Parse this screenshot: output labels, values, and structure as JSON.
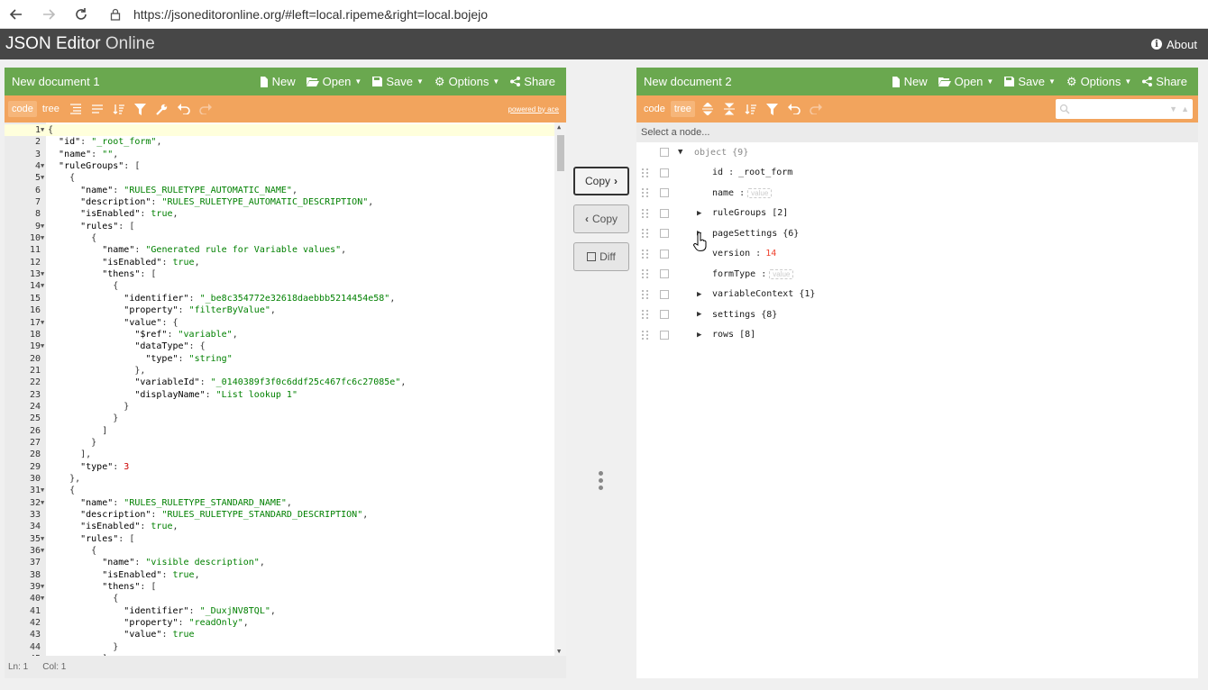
{
  "browser": {
    "url": "https://jsoneditoronline.org/#left=local.ripeme&right=local.bojejo"
  },
  "app": {
    "title_main": "JSON Editor",
    "title_light": "Online",
    "about": "About"
  },
  "left": {
    "title": "New document 1",
    "menu": {
      "new": "New",
      "open": "Open",
      "save": "Save",
      "options": "Options",
      "share": "Share"
    },
    "mode_code": "code",
    "mode_tree": "tree",
    "powered": "powered by ace",
    "status_ln": "Ln: 1",
    "status_col": "Col: 1"
  },
  "right": {
    "title": "New document 2",
    "menu": {
      "new": "New",
      "open": "Open",
      "save": "Save",
      "options": "Options",
      "share": "Share"
    },
    "mode_code": "code",
    "mode_tree": "tree",
    "nav_placeholder": "Select a node..."
  },
  "center": {
    "copy_right": "Copy",
    "copy_left": "Copy",
    "diff": "Diff"
  },
  "code_lines": [
    "{",
    "  \"id\": \"_root_form\",",
    "  \"name\": \"\",",
    "  \"ruleGroups\": [",
    "    {",
    "      \"name\": \"RULES_RULETYPE_AUTOMATIC_NAME\",",
    "      \"description\": \"RULES_RULETYPE_AUTOMATIC_DESCRIPTION\",",
    "      \"isEnabled\": true,",
    "      \"rules\": [",
    "        {",
    "          \"name\": \"Generated rule for Variable values\",",
    "          \"isEnabled\": true,",
    "          \"thens\": [",
    "            {",
    "              \"identifier\": \"_be8c354772e32618daebbb5214454e58\",",
    "              \"property\": \"filterByValue\",",
    "              \"value\": {",
    "                \"$ref\": \"variable\",",
    "                \"dataType\": {",
    "                  \"type\": \"string\"",
    "                },",
    "                \"variableId\": \"_0140389f3f0c6ddf25c467fc6c27085e\",",
    "                \"displayName\": \"List lookup 1\"",
    "              }",
    "            }",
    "          ]",
    "        }",
    "      ],",
    "      \"type\": 3",
    "    },",
    "    {",
    "      \"name\": \"RULES_RULETYPE_STANDARD_NAME\",",
    "      \"description\": \"RULES_RULETYPE_STANDARD_DESCRIPTION\",",
    "      \"isEnabled\": true,",
    "      \"rules\": [",
    "        {",
    "          \"name\": \"visible description\",",
    "          \"isEnabled\": true,",
    "          \"thens\": [",
    "            {",
    "              \"identifier\": \"_DuxjNV8TQL\",",
    "              \"property\": \"readOnly\",",
    "              \"value\": true",
    "            }",
    "          ]"
  ],
  "fold_lines": [
    1,
    4,
    5,
    9,
    10,
    13,
    14,
    17,
    19,
    31,
    32,
    35,
    36,
    39,
    40
  ],
  "tree": {
    "root_key": "object",
    "root_count": "{9}",
    "rows": [
      {
        "key": "id",
        "sep": ":",
        "value": "_root_form",
        "kind": "string",
        "expandable": false
      },
      {
        "key": "name",
        "sep": ":",
        "value": "value",
        "kind": "placeholder",
        "expandable": false
      },
      {
        "key": "ruleGroups",
        "sep": "",
        "value": "[2]",
        "kind": "count",
        "expandable": true
      },
      {
        "key": "pageSettings",
        "sep": "",
        "value": "{6}",
        "kind": "count",
        "expandable": true
      },
      {
        "key": "version",
        "sep": ":",
        "value": "14",
        "kind": "number",
        "expandable": false
      },
      {
        "key": "formType",
        "sep": ":",
        "value": "value",
        "kind": "placeholder",
        "expandable": false
      },
      {
        "key": "variableContext",
        "sep": "",
        "value": "{1}",
        "kind": "count",
        "expandable": true
      },
      {
        "key": "settings",
        "sep": "",
        "value": "{8}",
        "kind": "count",
        "expandable": true
      },
      {
        "key": "rows",
        "sep": "",
        "value": "[8]",
        "kind": "count",
        "expandable": true
      }
    ]
  }
}
